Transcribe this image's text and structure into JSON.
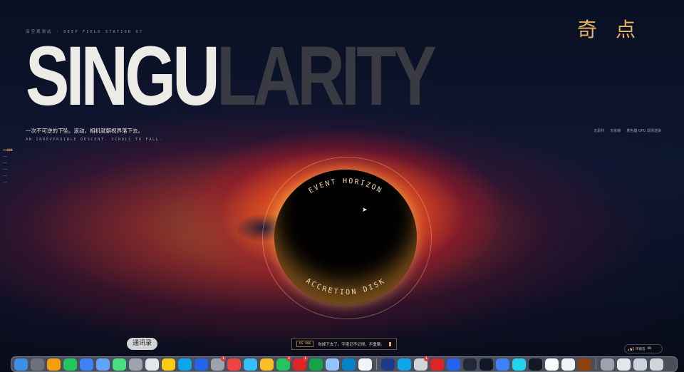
{
  "header": {
    "kicker": "深空观测站 · DEEP FIELD STATION 07",
    "hero_part1": "SINGU",
    "hero_part2": "LARITY",
    "cjk_title": "奇点"
  },
  "tagline": {
    "zh": "一次不可逆的下坠。滚动，相机就朝视界落下去。",
    "en": "AN IRREVERSIBLE DESCENT. SCROLL TO FALL."
  },
  "features": [
    "无素材",
    "无依赖",
    "着色器 GPU 现场渲染"
  ],
  "scroll_indicator": {
    "label": "000"
  },
  "black_hole": {
    "top_label": "EVENT HORIZON",
    "bottom_label": "ACCRETION DISK"
  },
  "status_bar": {
    "code": "RS 906",
    "text": "你掉下去了。宇宙记不记得，不重要。"
  },
  "sound_toggle": {
    "label": "环境音",
    "state": "ON"
  },
  "dock": {
    "tooltip": "通讯录",
    "apps": [
      {
        "name": "finder-icon",
        "color": "#3b8fe6"
      },
      {
        "name": "launchpad-icon",
        "color": "#6b7280"
      },
      {
        "name": "photos-icon",
        "color": "#f59e0b"
      },
      {
        "name": "wechat-icon",
        "color": "#22c55e"
      },
      {
        "name": "safari-icon",
        "color": "#3b82f6"
      },
      {
        "name": "mail-icon",
        "color": "#60a5fa"
      },
      {
        "name": "messages-icon",
        "color": "#4ade80"
      },
      {
        "name": "contacts-icon",
        "color": "#9ca3af"
      },
      {
        "name": "reminders-icon",
        "color": "#e5e7eb"
      },
      {
        "name": "notes-icon",
        "color": "#facc15"
      },
      {
        "name": "translate-icon",
        "color": "#0ea5e9"
      },
      {
        "name": "appstore-icon",
        "color": "#2563eb"
      },
      {
        "name": "settings-icon",
        "color": "#9ca3af",
        "badge": "1"
      },
      {
        "name": "music-icon",
        "color": "#ef4444"
      },
      {
        "name": "maps-icon",
        "color": "#38bdf8"
      },
      {
        "name": "chrome-icon",
        "color": "#fbbf24"
      },
      {
        "name": "wechat-work-icon",
        "color": "#22c55e",
        "badge": "2"
      },
      {
        "name": "netease-icon",
        "color": "#dc2626",
        "badge": "1"
      },
      {
        "name": "numbers-icon",
        "color": "#16a34a"
      },
      {
        "name": "preview-icon",
        "color": "#93c5fd"
      },
      {
        "name": "network-icon",
        "color": "#0284c7"
      },
      {
        "name": "obsidian-icon",
        "color": "#f3f4f6"
      }
    ],
    "apps_right": [
      {
        "name": "photoshop-icon",
        "color": "#1e3a8a"
      },
      {
        "name": "feishu-icon",
        "color": "#0ea5e9"
      },
      {
        "name": "xmind-icon",
        "color": "#d1d5db",
        "badge": "1"
      },
      {
        "name": "pdf-icon",
        "color": "#dc2626"
      },
      {
        "name": "cloud-icon",
        "color": "#2563eb"
      },
      {
        "name": "calculator-icon",
        "color": "#1f2937"
      },
      {
        "name": "terminal-icon",
        "color": "#111827"
      },
      {
        "name": "swift-icon",
        "color": "#3b82f6"
      },
      {
        "name": "edge-icon",
        "color": "#22d3ee"
      },
      {
        "name": "cursor-app-icon",
        "color": "#111827"
      },
      {
        "name": "github-icon",
        "color": "#f9fafb"
      },
      {
        "name": "panda-icon",
        "color": "#f3f4f6"
      },
      {
        "name": "bird-icon",
        "color": "#92400e"
      }
    ],
    "apps_trailing": [
      {
        "name": "downloads-icon",
        "color": "#9ca3af"
      },
      {
        "name": "window-icon",
        "color": "#e5e7eb"
      },
      {
        "name": "documents-icon",
        "color": "#cbd5e1"
      },
      {
        "name": "trash-icon",
        "color": "#d1d5db"
      }
    ]
  }
}
